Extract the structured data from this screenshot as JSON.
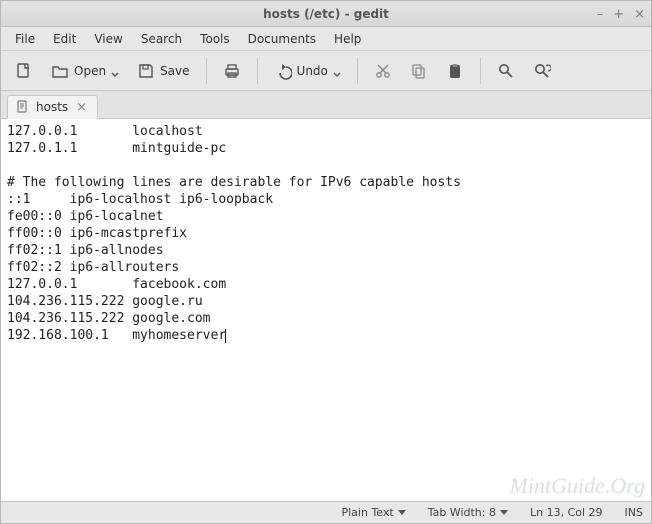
{
  "window": {
    "title": "hosts (/etc) - gedit"
  },
  "menu": {
    "file": "File",
    "edit": "Edit",
    "view": "View",
    "search": "Search",
    "tools": "Tools",
    "documents": "Documents",
    "help": "Help"
  },
  "toolbar": {
    "open": "Open",
    "save": "Save",
    "undo": "Undo"
  },
  "tab": {
    "label": "hosts"
  },
  "editor": {
    "content": "127.0.0.1       localhost\n127.0.1.1       mintguide-pc\n\n# The following lines are desirable for IPv6 capable hosts\n::1     ip6-localhost ip6-loopback\nfe00::0 ip6-localnet\nff00::0 ip6-mcastprefix\nff02::1 ip6-allnodes\nff02::2 ip6-allrouters\n127.0.0.1       facebook.com\n104.236.115.222 google.ru\n104.236.115.222 google.com\n192.168.100.1   myhomeserver"
  },
  "status": {
    "language": "Plain Text",
    "tabwidth": "Tab Width: 8",
    "position": "Ln 13, Col 29",
    "insert": "INS"
  },
  "watermark": {
    "text1": "MintGuide.",
    "text2": "Org"
  }
}
